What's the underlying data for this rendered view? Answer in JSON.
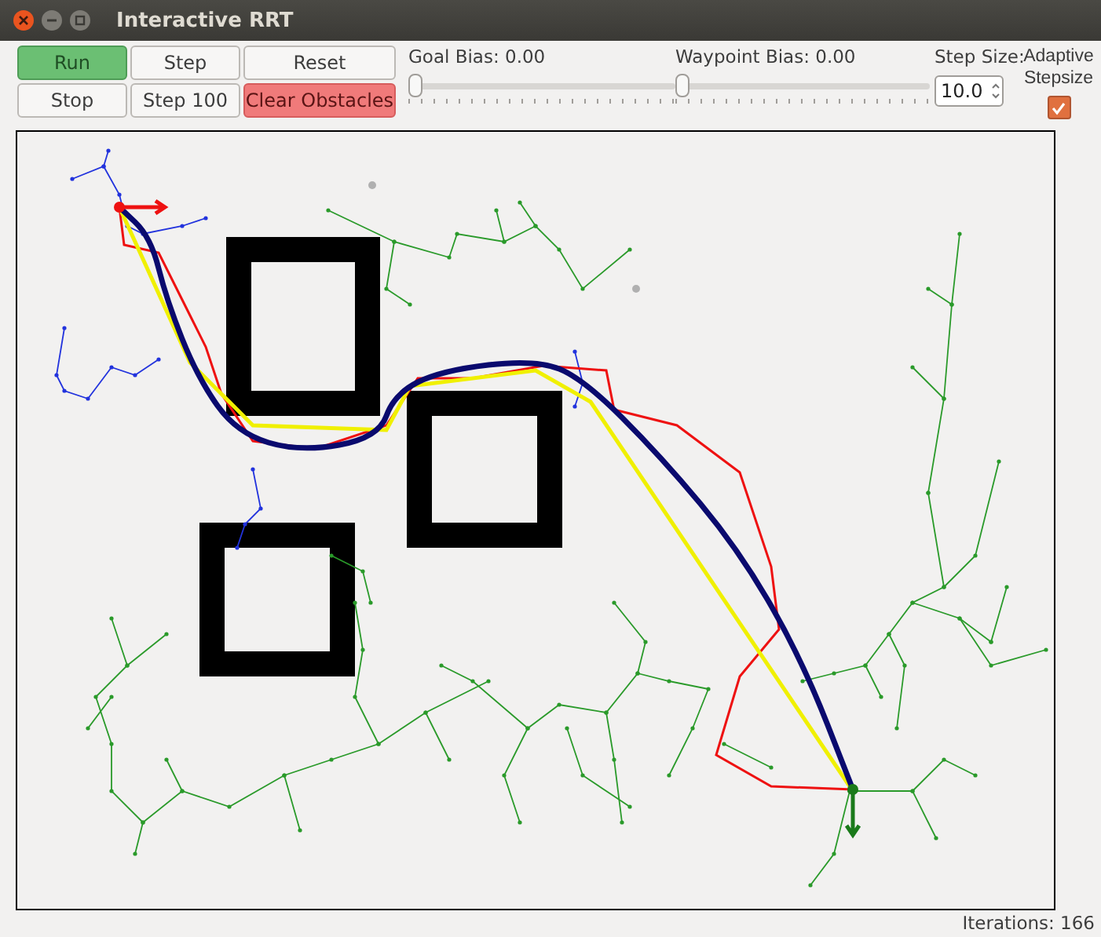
{
  "window": {
    "title": "Interactive RRT"
  },
  "buttons": [
    {
      "label": "Run",
      "kind": "run"
    },
    {
      "label": "Step",
      "kind": "normal"
    },
    {
      "label": "Reset",
      "kind": "normal"
    },
    {
      "label": "Stop",
      "kind": "normal"
    },
    {
      "label": "Step 100",
      "kind": "normal"
    },
    {
      "label": "Clear Obstacles",
      "kind": "clear"
    }
  ],
  "sliders": [
    {
      "label": "Goal Bias: 0.00",
      "level": 0
    },
    {
      "label": "Waypoint Bias: 0.00",
      "level": 0
    }
  ],
  "step_size": {
    "label": "Step Size:",
    "value": "10.0"
  },
  "adaptive_stepsize": {
    "label": "Adaptive Stepsize",
    "checked": true
  },
  "status_bar": {
    "text": "Iterations: 166"
  }
}
